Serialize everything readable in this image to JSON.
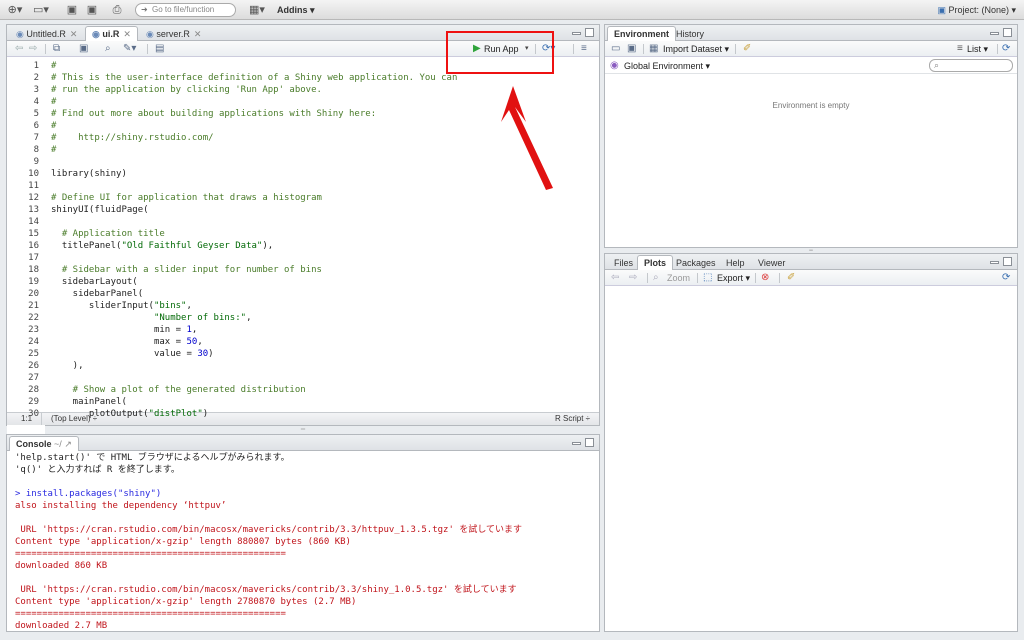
{
  "topbar": {
    "goto_placeholder": "Go to file/function",
    "addins_label": "Addins ▾",
    "project_label": "Project: (None) ▾"
  },
  "editor": {
    "tabs": [
      {
        "label": "Untitled.R"
      },
      {
        "label": "ui.R"
      },
      {
        "label": "server.R"
      }
    ],
    "run_app_label": "Run App",
    "lines": [
      {
        "n": "1",
        "text": "#"
      },
      {
        "n": "2",
        "text": "# This is the user-interface definition of a Shiny web application. You can"
      },
      {
        "n": "3",
        "text": "# run the application by clicking 'Run App' above."
      },
      {
        "n": "4",
        "text": "#"
      },
      {
        "n": "5",
        "text": "# Find out more about building applications with Shiny here:"
      },
      {
        "n": "6",
        "text": "#"
      },
      {
        "n": "7",
        "text": "#    http://shiny.rstudio.com/"
      },
      {
        "n": "8",
        "text": "#"
      },
      {
        "n": "9",
        "text": ""
      },
      {
        "n": "10",
        "text": "library(shiny)"
      },
      {
        "n": "11",
        "text": ""
      },
      {
        "n": "12",
        "text": "# Define UI for application that draws a histogram"
      },
      {
        "n": "13",
        "text": "shinyUI(fluidPage("
      },
      {
        "n": "14",
        "text": ""
      },
      {
        "n": "15",
        "text": "  # Application title"
      },
      {
        "n": "16",
        "text": "  titlePanel(\"Old Faithful Geyser Data\"),"
      },
      {
        "n": "17",
        "text": ""
      },
      {
        "n": "18",
        "text": "  # Sidebar with a slider input for number of bins"
      },
      {
        "n": "19",
        "text": "  sidebarLayout("
      },
      {
        "n": "20",
        "text": "    sidebarPanel("
      },
      {
        "n": "21",
        "text": "       sliderInput(\"bins\","
      },
      {
        "n": "22",
        "text": "                   \"Number of bins:\","
      },
      {
        "n": "23",
        "text": "                   min = 1,"
      },
      {
        "n": "24",
        "text": "                   max = 50,"
      },
      {
        "n": "25",
        "text": "                   value = 30)"
      },
      {
        "n": "26",
        "text": "    ),"
      },
      {
        "n": "27",
        "text": ""
      },
      {
        "n": "28",
        "text": "    # Show a plot of the generated distribution"
      },
      {
        "n": "29",
        "text": "    mainPanel("
      },
      {
        "n": "30",
        "text": "       plotOutput(\"distPlot\")"
      }
    ],
    "status_position": "1:1",
    "status_scope": "(Top Level) ÷",
    "status_filetype": "R Script ÷"
  },
  "console": {
    "tab_label": "Console",
    "path": "~/",
    "lines": [
      {
        "text": "'help.start()' で HTML ブラウザによるヘルプがみられます。",
        "color": "blk"
      },
      {
        "text": "'q()' と入力すれば R を終了します。",
        "color": "blk"
      },
      {
        "text": "",
        "color": "blk"
      },
      {
        "text": "> install.packages(\"shiny\")",
        "color": "blue"
      },
      {
        "text": "also installing the dependency ‘httpuv’",
        "color": "red"
      },
      {
        "text": "",
        "color": "red"
      },
      {
        "text": " URL 'https://cran.rstudio.com/bin/macosx/mavericks/contrib/3.3/httpuv_1.3.5.tgz' を試しています",
        "color": "red"
      },
      {
        "text": "Content type 'application/x-gzip' length 880807 bytes (860 KB)",
        "color": "red"
      },
      {
        "text": "==================================================",
        "color": "red"
      },
      {
        "text": "downloaded 860 KB",
        "color": "red"
      },
      {
        "text": "",
        "color": "red"
      },
      {
        "text": " URL 'https://cran.rstudio.com/bin/macosx/mavericks/contrib/3.3/shiny_1.0.5.tgz' を試しています",
        "color": "red"
      },
      {
        "text": "Content type 'application/x-gzip' length 2780870 bytes (2.7 MB)",
        "color": "red"
      },
      {
        "text": "==================================================",
        "color": "red"
      },
      {
        "text": "downloaded 2.7 MB",
        "color": "red"
      }
    ]
  },
  "environment": {
    "tabs": [
      {
        "label": "Environment"
      },
      {
        "label": "History"
      }
    ],
    "import_label": "Import Dataset ▾",
    "list_label": "List ▾",
    "scope_label": "Global Environment ▾",
    "empty_message": "Environment is empty"
  },
  "files_pane": {
    "tabs": [
      {
        "label": "Files"
      },
      {
        "label": "Plots"
      },
      {
        "label": "Packages"
      },
      {
        "label": "Help"
      },
      {
        "label": "Viewer"
      }
    ],
    "zoom_label": "Zoom",
    "export_label": "Export ▾"
  },
  "colors": {
    "highlight": "#e11111",
    "arrow": "#e11111"
  }
}
